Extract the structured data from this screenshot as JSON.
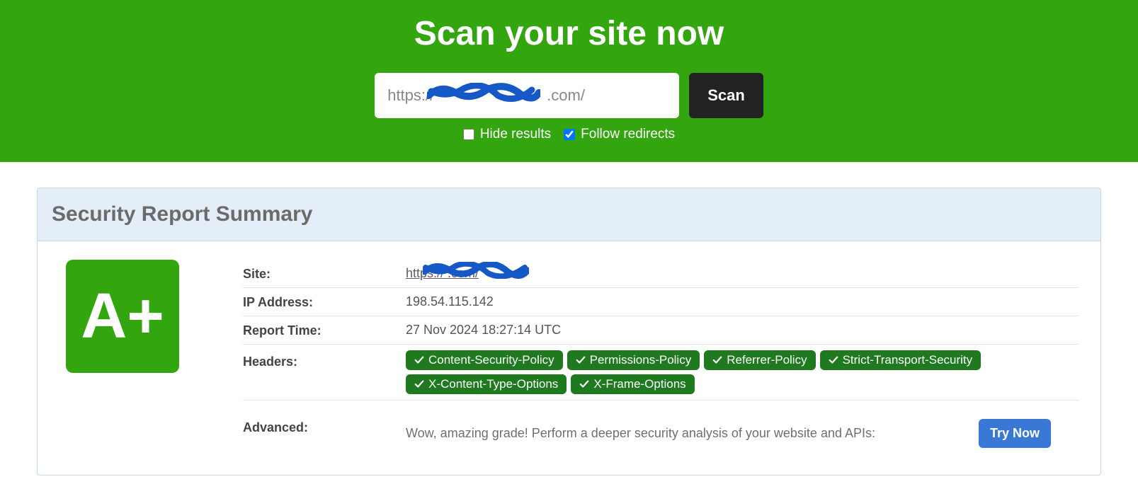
{
  "hero": {
    "title": "Scan your site now",
    "url_value": "https://                          .com/",
    "scan_label": "Scan",
    "hide_results_label": "Hide results",
    "follow_redirects_label": "Follow redirects",
    "hide_results_checked": false,
    "follow_redirects_checked": true
  },
  "report": {
    "title": "Security Report Summary",
    "grade": "A+",
    "rows": {
      "site_label": "Site:",
      "site_value": "https://                          .com/",
      "ip_label": "IP Address:",
      "ip_value": "198.54.115.142",
      "time_label": "Report Time:",
      "time_value": "27 Nov 2024 18:27:14 UTC",
      "headers_label": "Headers:",
      "advanced_label": "Advanced:",
      "advanced_text": "Wow, amazing grade! Perform a deeper security analysis of your website and APIs:",
      "try_now_label": "Try Now"
    },
    "header_pills": [
      "Content-Security-Policy",
      "Permissions-Policy",
      "Referrer-Policy",
      "Strict-Transport-Security",
      "X-Content-Type-Options",
      "X-Frame-Options"
    ]
  }
}
